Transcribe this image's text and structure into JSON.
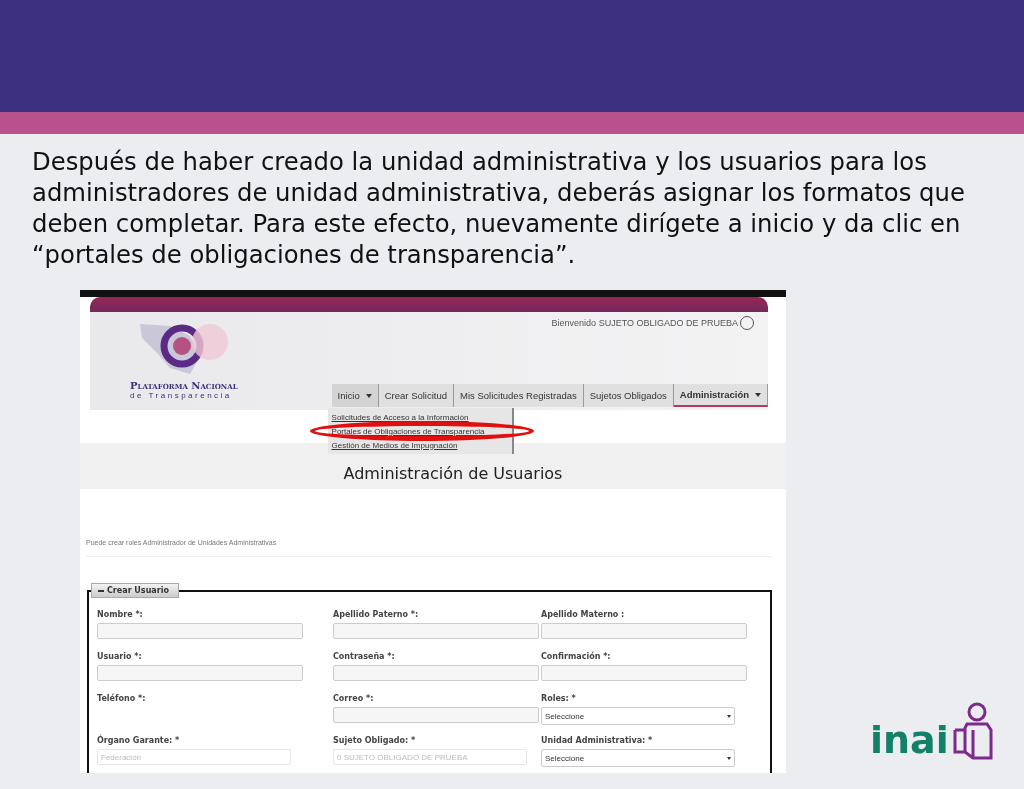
{
  "slide": {
    "paragraph": "Después de haber creado la unidad administrativa y los usuarios para los administradores de unidad administrativa, deberás asignar los formatos que deben completar. Para este efecto, nuevamente dirígete a inicio y da clic en “portales de obligaciones de transparencia”."
  },
  "screenshot": {
    "header": {
      "logo_line1": "Plataforma Nacional",
      "logo_line2": "de Transparencia",
      "welcome": "Bienvenido SUJETO OBLIGADO DE PRUEBA"
    },
    "nav": [
      {
        "label": "Inicio",
        "caret": true,
        "selected": false,
        "expanded": true
      },
      {
        "label": "Crear Solicitud",
        "caret": false,
        "selected": false,
        "expanded": false
      },
      {
        "label": "Mis Solicitudes Registradas",
        "caret": false,
        "selected": false,
        "expanded": false
      },
      {
        "label": "Sujetos Obligados",
        "caret": false,
        "selected": false,
        "expanded": false
      },
      {
        "label": "Administración",
        "caret": true,
        "selected": true,
        "expanded": false
      }
    ],
    "dropdown_menu": [
      {
        "label": "Solicitudes de Acceso a la Información",
        "circled": false
      },
      {
        "label": "Portales de Obligaciones de Transparencia",
        "circled": true
      },
      {
        "label": "Gestión de Medios de Impugnación",
        "circled": false
      }
    ],
    "page_title": "Administración de Usuarios",
    "info_text": "Puede crear roles Administrador de Unidades Administrativas",
    "legend": "Crear Usuario",
    "fields": [
      {
        "label": "Nombre *:",
        "kind": "text"
      },
      {
        "label": "Apellido Paterno *:",
        "kind": "text"
      },
      {
        "label": "Apellido Materno :",
        "kind": "text"
      },
      {
        "label": "Usuario *:",
        "kind": "text"
      },
      {
        "label": "Contraseña *:",
        "kind": "text"
      },
      {
        "label": "Confirmación *:",
        "kind": "text"
      },
      {
        "label": "Teléfono *:",
        "kind": "none"
      },
      {
        "label": "Correo *:",
        "kind": "text"
      },
      {
        "label": "Roles: *",
        "kind": "select",
        "value": "Seleccione"
      },
      {
        "label": "Órgano Garante: *",
        "kind": "disabled",
        "placeholder": "Federación"
      },
      {
        "label": "Sujeto Obligado: *",
        "kind": "disabled",
        "placeholder": "0 SUJETO OBLIGADO DE PRUEBA"
      },
      {
        "label": "Unidad Administrativa: *",
        "kind": "select",
        "value": "Seleccione"
      }
    ]
  },
  "brand": {
    "logo_text": "inai"
  }
}
